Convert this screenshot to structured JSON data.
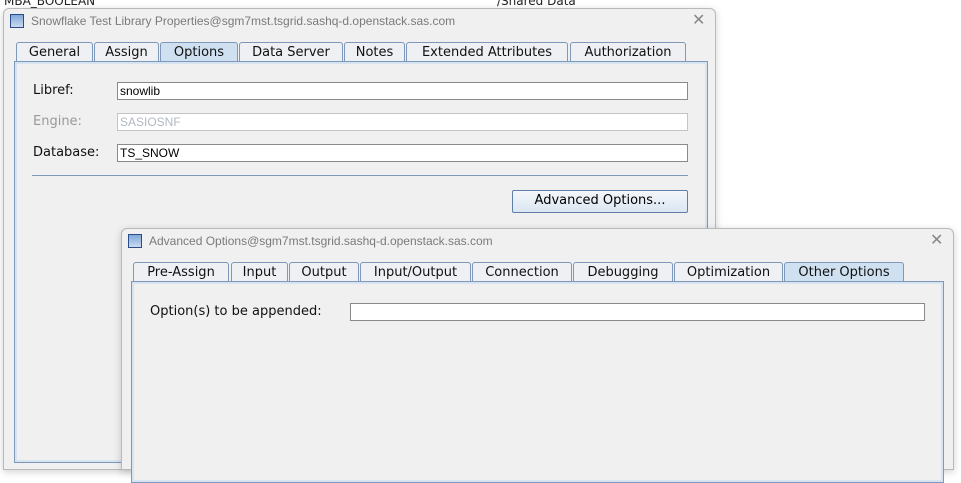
{
  "background": {
    "left_text": "MBA_BOOLEAN",
    "right_text": "/Shared Data"
  },
  "main_window": {
    "title": "Snowflake Test Library Properties@sgm7mst.tsgrid.sashq-d.openstack.sas.com",
    "tabs": [
      "General",
      "Assign",
      "Options",
      "Data Server",
      "Notes",
      "Extended Attributes",
      "Authorization"
    ],
    "selected_tab": "Options",
    "libref_label": "Libref:",
    "libref_value": "snowlib",
    "engine_label": "Engine:",
    "engine_value": "SASIOSNF",
    "database_label": "Database:",
    "database_value": "TS_SNOW",
    "advanced_button": "Advanced Options..."
  },
  "advanced_window": {
    "title": "Advanced Options@sgm7mst.tsgrid.sashq-d.openstack.sas.com",
    "tabs": [
      "Pre-Assign",
      "Input",
      "Output",
      "Input/Output",
      "Connection",
      "Debugging",
      "Optimization",
      "Other Options"
    ],
    "selected_tab": "Other Options",
    "options_label": "Option(s) to be appended:",
    "options_value": ""
  }
}
